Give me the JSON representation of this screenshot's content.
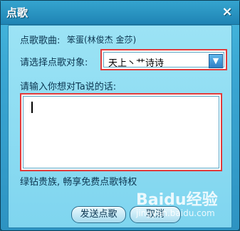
{
  "window": {
    "title": "点歌",
    "close_glyph": "×"
  },
  "form": {
    "song_label": "点歌歌曲:",
    "song_value": "笨蛋(林俊杰 金莎)",
    "target_label": "请选择点歌对象:",
    "target_selected": "天上丶艹诗诗",
    "arrow_glyph": "▼",
    "message_label": "请输入你想对Ta说的话:",
    "message_value": ""
  },
  "promo": "绿钻贵族, 畅享免费点歌特权",
  "buttons": {
    "send": "发送点歌",
    "cancel": "取消"
  },
  "watermark": {
    "brand": "Baidu经验",
    "url": "jingyan.baidu.com"
  }
}
